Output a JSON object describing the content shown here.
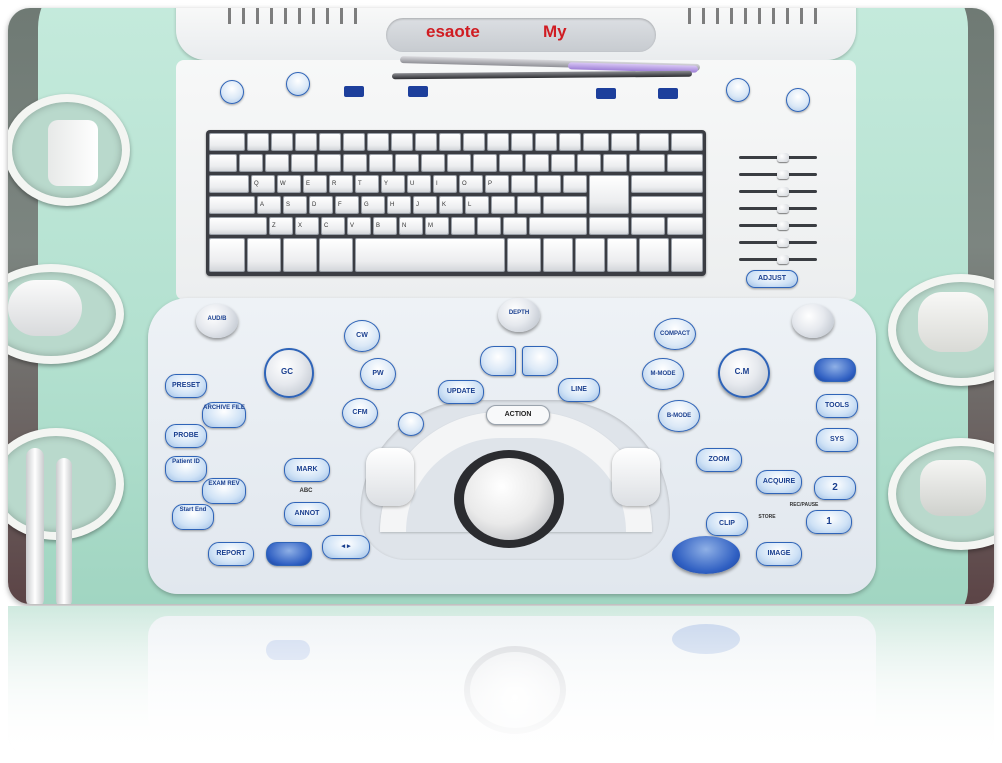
{
  "brand": {
    "logo_left": "esaote",
    "logo_right": "My"
  },
  "keyboard": {
    "row_q": [
      "Q",
      "W",
      "E",
      "R",
      "T",
      "Y",
      "U",
      "I",
      "O",
      "P"
    ],
    "row_a": [
      "A",
      "S",
      "D",
      "F",
      "G",
      "H",
      "J",
      "K",
      "L"
    ],
    "row_z": [
      "Z",
      "X",
      "C",
      "V",
      "B",
      "N",
      "M"
    ]
  },
  "sliders_label": "ADJUST",
  "buttons": {
    "preset": "PRESET",
    "probe": "PROBE",
    "patient_id": "Patient ID",
    "start_end": "Start End",
    "report": "REPORT",
    "archive": "ARCHIVE FILE",
    "exam_rev": "EXAM REV",
    "mark": "MARK",
    "abc": "ABC",
    "annot": "ANNOT",
    "cw": "CW",
    "pw": "PW",
    "cfm": "CFM",
    "update": "UPDATE",
    "action": "ACTION",
    "line": "LINE",
    "m_mode": "M-MODE",
    "b_mode": "B-MODE",
    "zoom": "ZOOM",
    "acquire": "ACQUIRE",
    "clip": "CLIP",
    "image": "IMAGE",
    "store": "STORE",
    "tools": "TOOLS",
    "sys": "SYS",
    "num2": "2",
    "num1": "1",
    "rec_pause": "REC/PAUSE",
    "gc": "GC",
    "cm": "C.M",
    "depth": "DEPTH",
    "compact": "COMPACT",
    "aud": "AUD/B"
  },
  "colors": {
    "housing": "#b9e3d3",
    "panel": "#e7edf2",
    "button_border": "#2f64b8",
    "label": "#1a3f8f"
  }
}
